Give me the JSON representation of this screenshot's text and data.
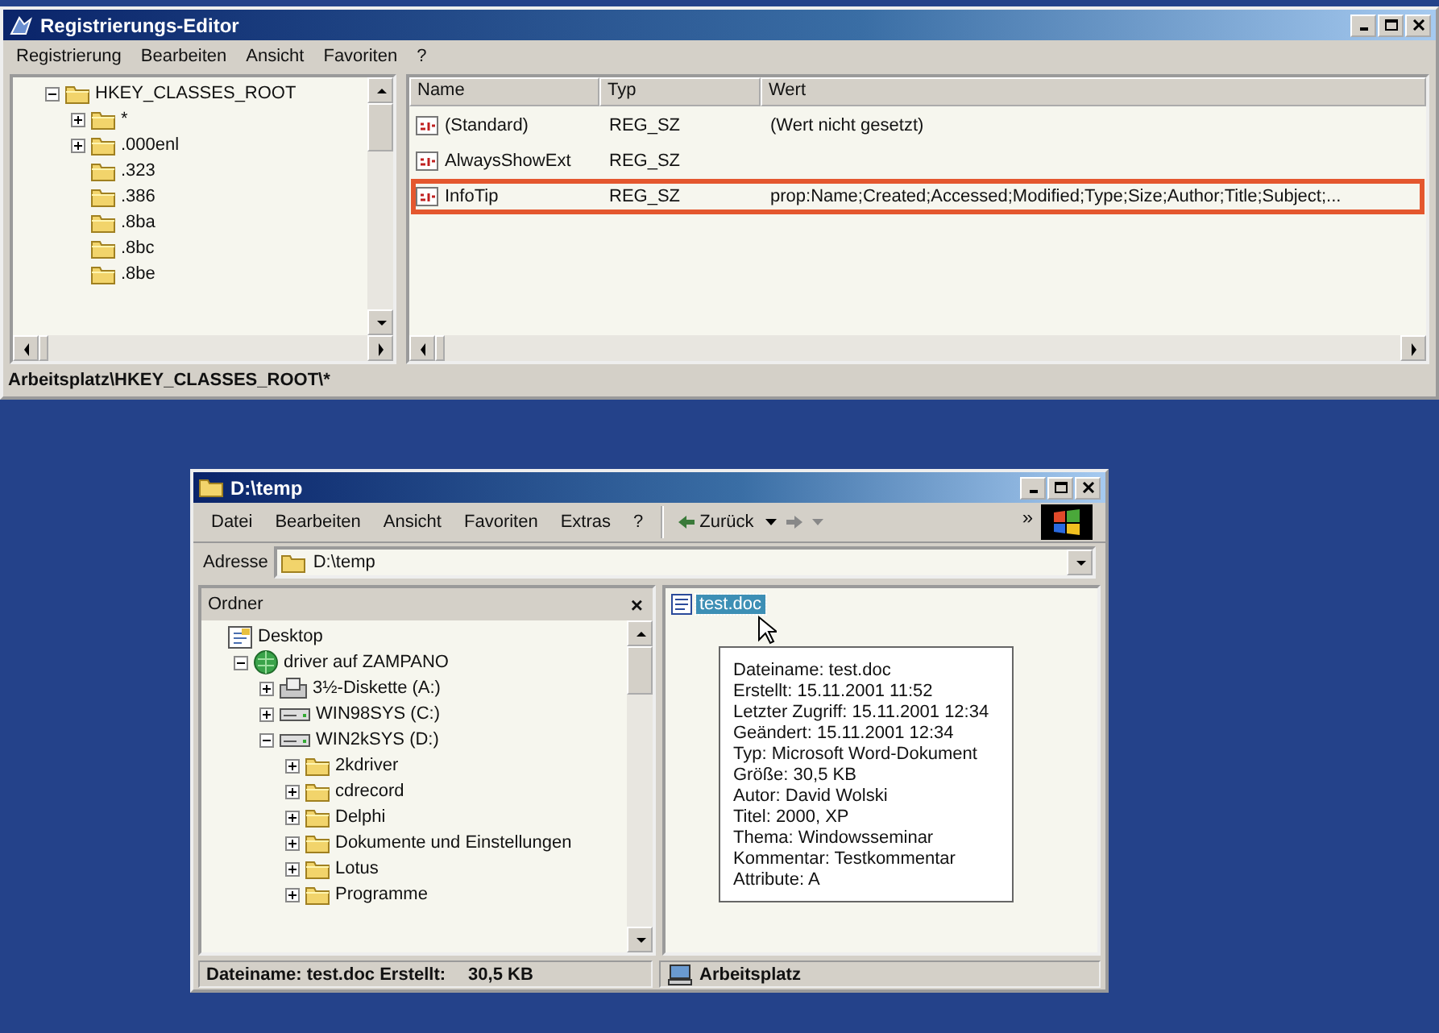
{
  "registry_window": {
    "title": "Registrierungs-Editor",
    "menu": [
      "Registrierung",
      "Bearbeiten",
      "Ansicht",
      "Favoriten",
      "?"
    ],
    "tree": [
      {
        "label": "HKEY_CLASSES_ROOT",
        "kind": "folder",
        "expanded": true,
        "children": [
          {
            "label": "*",
            "kind": "folder",
            "expanded": false
          },
          {
            "label": ".000enl",
            "kind": "folder",
            "expanded": false
          },
          {
            "label": ".323",
            "kind": "folder"
          },
          {
            "label": ".386",
            "kind": "folder"
          },
          {
            "label": ".8ba",
            "kind": "folder"
          },
          {
            "label": ".8bc",
            "kind": "folder"
          },
          {
            "label": ".8be",
            "kind": "folder"
          }
        ]
      }
    ],
    "values": {
      "columns": [
        "Name",
        "Typ",
        "Wert"
      ],
      "rows": [
        {
          "name": "(Standard)",
          "type": "REG_SZ",
          "value": "(Wert nicht gesetzt)",
          "highlighted": false
        },
        {
          "name": "AlwaysShowExt",
          "type": "REG_SZ",
          "highlighted": false
        },
        {
          "name": "InfoTip",
          "type": "REG_SZ",
          "value": "prop:Name;Created;Accessed;Modified;Type;Size;Author;Title;Subject;...",
          "highlighted": true
        }
      ]
    },
    "status_bar": "Arbeitsplatz\\HKEY_CLASSES_ROOT\\*"
  },
  "explorer_window": {
    "title": "D:\\temp",
    "menu": [
      "Datei",
      "Bearbeiten",
      "Ansicht",
      "Favoriten",
      "Extras",
      "?"
    ],
    "toolbar": {
      "back_label": "Zurück",
      "chevron": "»"
    },
    "address": {
      "label": "Adresse",
      "value": "D:\\temp"
    },
    "folders": {
      "title": "Ordner",
      "close": "×",
      "tree": [
        {
          "label": "Desktop",
          "kind": "desktop",
          "children": [
            {
              "label": "driver auf ZAMPANO",
              "kind": "network",
              "expanded": true,
              "children": [
                {
                  "label": "3½-Diskette (A:)",
                  "kind": "floppy",
                  "expanded": false
                },
                {
                  "label": "WIN98SYS (C:)",
                  "kind": "drive",
                  "expanded": false
                },
                {
                  "label": "WIN2kSYS (D:)",
                  "kind": "drive",
                  "expanded": true,
                  "children": [
                    {
                      "label": "2kdriver",
                      "kind": "folder",
                      "expanded": false
                    },
                    {
                      "label": "cdrecord",
                      "kind": "folder",
                      "expanded": false
                    },
                    {
                      "label": "Delphi",
                      "kind": "folder",
                      "expanded": false
                    },
                    {
                      "label": "Dokumente und Einstellungen",
                      "kind": "folder",
                      "expanded": false
                    },
                    {
                      "label": "Lotus",
                      "kind": "folder",
                      "expanded": false
                    },
                    {
                      "label": "Programme",
                      "kind": "folder",
                      "expanded": false
                    }
                  ]
                }
              ]
            }
          ]
        }
      ]
    },
    "files": [
      {
        "name": "test.doc",
        "selected": true
      }
    ],
    "tooltip": [
      "Dateiname: test.doc",
      "Erstellt: 15.11.2001 11:52",
      "Letzter Zugriff: 15.11.2001 12:34",
      "Geändert: 15.11.2001 12:34",
      "Typ: Microsoft Word-Dokument",
      "Größe: 30,5 KB",
      "Autor: David Wolski",
      "Titel: 2000, XP",
      "Thema: Windowsseminar",
      "Kommentar: Testkommentar",
      "Attribute: A"
    ],
    "status_bar": {
      "details": "Dateiname: test.doc Erstellt:",
      "size": "30,5 KB",
      "zone": "Arbeitsplatz"
    }
  }
}
